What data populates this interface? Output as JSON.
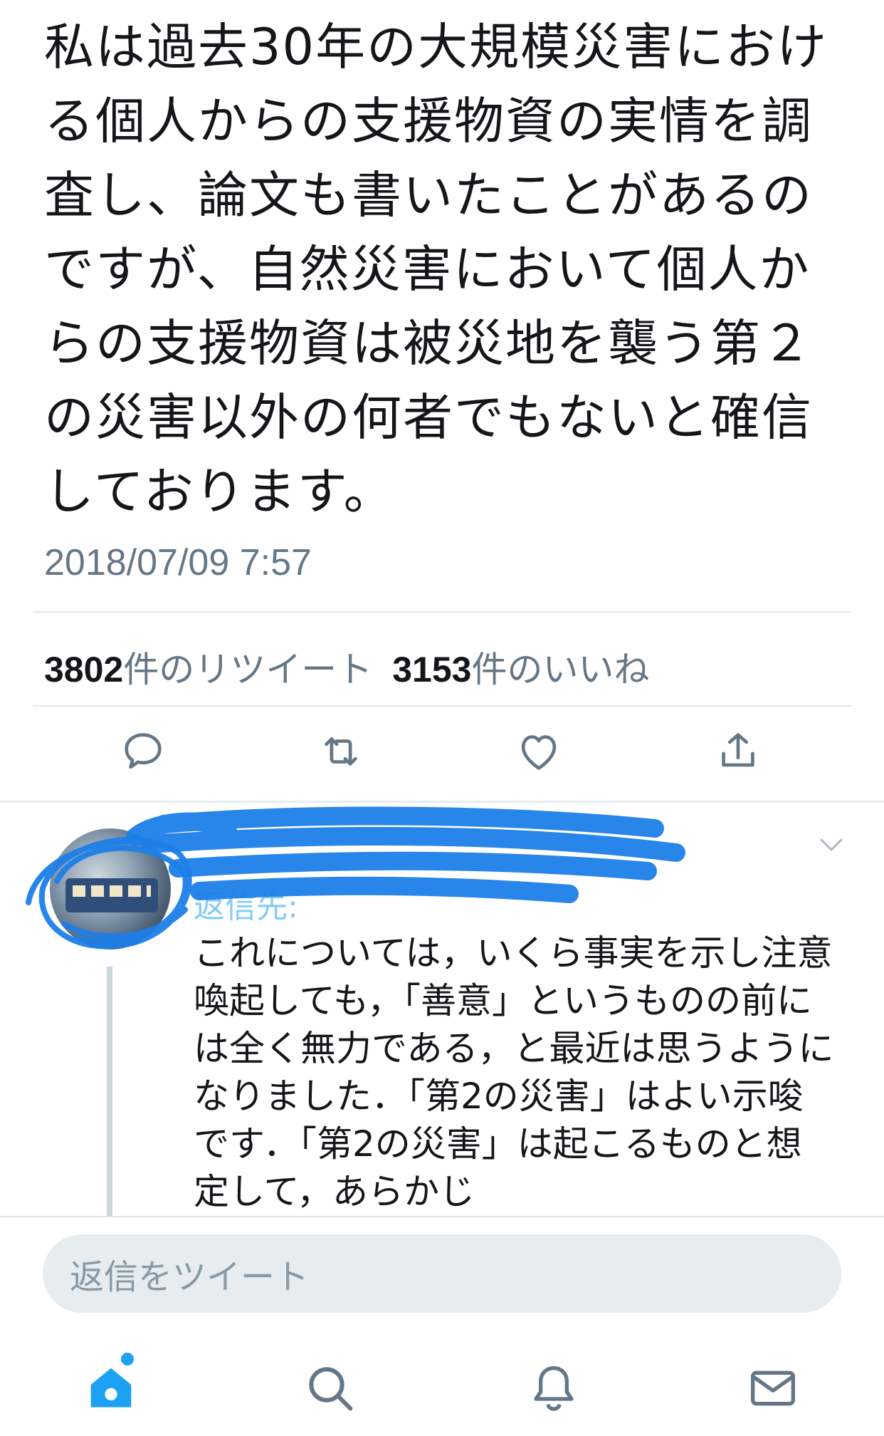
{
  "tweet": {
    "text": "私は過去30年の大規模災害における個人からの支援物資の実情を調査し、論文も書いたことがあるのですが、自然災害において個人からの支援物資は被災地を襲う第２の災害以外の何者でもないと確信しております。",
    "timestamp": "2018/07/09 7:57",
    "retweet_count": "3802",
    "retweet_label": "件のリツイート",
    "like_count": "3153",
    "like_label": "件のいいね"
  },
  "actions": {
    "icons": [
      "reply-icon",
      "retweet-icon",
      "like-icon",
      "share-icon"
    ]
  },
  "reply": {
    "reply_to_prefix": "返信先:",
    "text": "これについては，いくら事実を示し注意喚起しても，「善意」というものの前には全く無力である，と最近は思うようになりました．「第2の災害」はよい示唆です．「第2の災害」は起こるものと想定して，あらかじ"
  },
  "composer": {
    "placeholder": "返信をツイート"
  },
  "tabbar": {
    "icons": [
      "home-icon",
      "search-icon",
      "notifications-icon",
      "messages-icon"
    ]
  },
  "colors": {
    "accent": "#1da1f2",
    "text": "#14171a",
    "secondary": "#657786",
    "scribble": "#1d7fe8"
  }
}
